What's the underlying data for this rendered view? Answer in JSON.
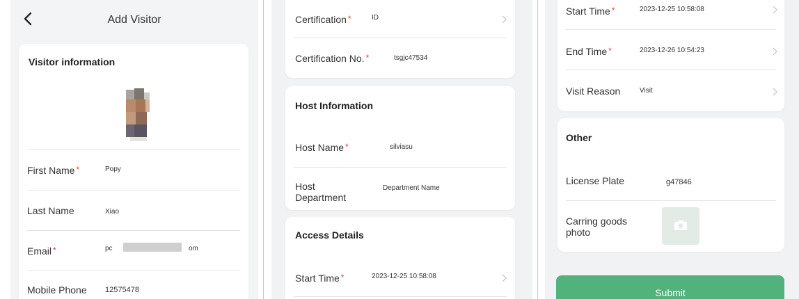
{
  "panel1": {
    "title": "Add Visitor",
    "section_title": "Visitor information",
    "fields": {
      "first_name_label": "First Name",
      "first_name_value": "Popy",
      "last_name_label": "Last Name",
      "last_name_value": "Xiao",
      "email_label": "Email",
      "email_value_start": "pc",
      "email_value_end": "om",
      "mobile_label": "Mobile Phone",
      "mobile_value": "12575478"
    },
    "required_mark": "*"
  },
  "panel2": {
    "certification_label": "Certification",
    "certification_value": "ID",
    "certification_no_label": "Certification No.",
    "certification_no_value": "tsgjc47534",
    "host_section_title": "Host Information",
    "host_name_label": "Host Name",
    "host_name_value": "silviasu",
    "host_department_label_1": "Host",
    "host_department_label_2": "Department",
    "host_department_value": "Department Name",
    "access_section_title": "Access Details",
    "start_time_label": "Start Time",
    "start_time_value": "2023-12-25 10:58:08"
  },
  "panel3": {
    "start_time_label": "Start Time",
    "start_time_value": "2023-12-25 10:58:08",
    "end_time_label": "End Time",
    "end_time_value": "2023-12-26 10:54:23",
    "visit_reason_label": "Visit Reason",
    "visit_reason_value": "Visit",
    "other_section_title": "Other",
    "license_plate_label": "License Plate",
    "license_plate_value": "g47846",
    "goods_photo_label_1": "Carring goods",
    "goods_photo_label_2": "photo",
    "submit_label": "Submit"
  },
  "colors": {
    "required": "#e4393c",
    "submit": "#52b27c",
    "background": "#f3f4f5",
    "card": "#ffffff"
  }
}
